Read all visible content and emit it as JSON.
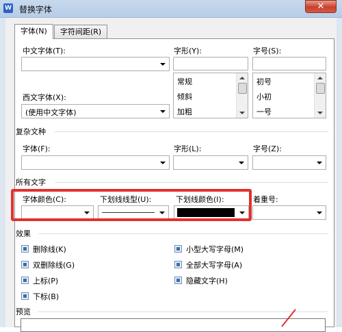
{
  "window": {
    "title": "替换字体",
    "app_icon_letter": "W",
    "close_glyph": "✕"
  },
  "tabs": [
    {
      "label": "字体(N)",
      "active": true
    },
    {
      "label": "字符间距(R)",
      "active": false
    }
  ],
  "font": {
    "chinese_font_label": "中文字体(T):",
    "chinese_font_value": "",
    "western_font_label": "西文字体(X):",
    "western_font_value": "(使用中文字体)",
    "style_label": "字形(Y):",
    "style_value": "",
    "style_options": [
      "常规",
      "倾斜",
      "加粗"
    ],
    "size_label": "字号(S):",
    "size_value": "",
    "size_options": [
      "初号",
      "小初",
      "一号"
    ]
  },
  "complex": {
    "section_title": "复杂文种",
    "font_label": "字体(F):",
    "style_label": "字形(L):",
    "size_label": "字号(Z):"
  },
  "all_text": {
    "section_title": "所有文字",
    "font_color_label": "字体颜色(C):",
    "underline_type_label": "下划线线型(U):",
    "underline_color_label": "下划线颜色(I):",
    "emphasis_label": "着重号:",
    "underline_color": "#000000"
  },
  "effects": {
    "section_title": "效果",
    "left": [
      "删除线(K)",
      "双删除线(G)",
      "上标(P)",
      "下标(B)"
    ],
    "right": [
      "小型大写字母(M)",
      "全部大写字母(A)",
      "隐藏文字(H)"
    ]
  },
  "preview": {
    "section_title": "预览"
  },
  "colors": {
    "highlight": "#e0312f",
    "checkbox": "#3d6ea8"
  }
}
